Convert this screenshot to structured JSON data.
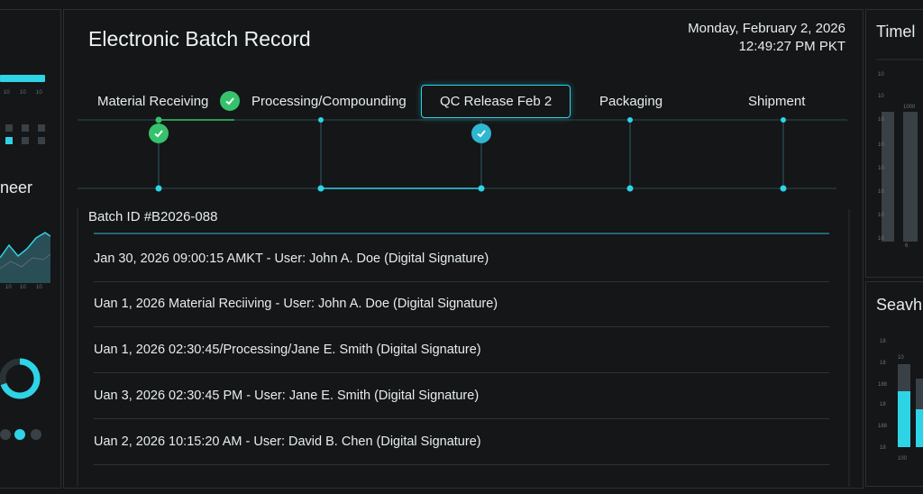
{
  "app": {
    "title": "Electronic Batch Record",
    "date": "Monday, February 2, 2026",
    "time": "12:49:27 PM PKT"
  },
  "stages": [
    {
      "label": "Material Receiving",
      "status": "complete"
    },
    {
      "label": "Processing/Compounding",
      "status": "pending"
    },
    {
      "label": "QC Release Feb 2",
      "status": "active"
    },
    {
      "label": "Packaging",
      "status": "pending"
    },
    {
      "label": "Shipment",
      "status": "pending"
    }
  ],
  "batch": {
    "id_label": "Batch ID #B2026-088",
    "log": [
      "Jan 30, 2026  09:00:15 AMKT - User: John A. Doe (Digital Signature)",
      "Uan 1, 2026 Material Reciiving - User: John A. Doe (Digital Signature)",
      "Uan 1, 2026  02:30:45/Processing/Jane E. Smith (Digital Signature)",
      "Uan 3, 2026  02:30:45 PM - User: Jane E. Smith (Digital Signature)",
      "Uan 2, 2026  10:15:20 AM - User: David B. Chen (Digital Signature)"
    ]
  },
  "left_panel": {
    "title": "neer",
    "ticks_top": [
      "10",
      "10",
      "10"
    ],
    "ticks_bottom": [
      "10",
      "10",
      "10"
    ]
  },
  "right_panel": {
    "top_title": "Timel",
    "bottom_title": "Seavh",
    "top_ticks": [
      "10",
      "10",
      "1000",
      "10",
      "10",
      "10",
      "10",
      "10",
      "10"
    ],
    "bottom_ticks": [
      "18",
      "18",
      "188",
      "18",
      "188",
      "18"
    ],
    "bar_labels": [
      "6",
      "10",
      "100"
    ]
  },
  "colors": {
    "accent": "#2fd3e6",
    "success": "#36c26c",
    "background": "#141617"
  },
  "icons": {
    "check": "check-icon"
  }
}
